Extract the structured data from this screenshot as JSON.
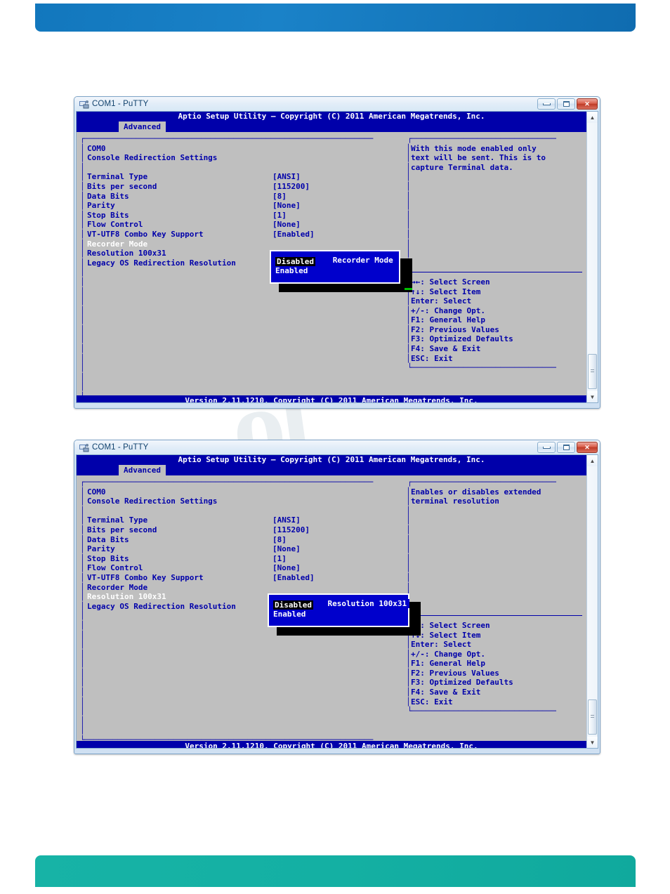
{
  "document": {
    "banner_top_color": "#1277bd",
    "banner_bottom_color": "#14b0a3",
    "watermark_text": "ol"
  },
  "windows": [
    {
      "id": "window-1",
      "titlebar": {
        "title": "COM1 - PuTTY",
        "minimize_label": "—",
        "maximize_label": "□",
        "close_label": "✕"
      },
      "bios": {
        "header": "Aptio Setup Utility – Copyright (C) 2011 American Megatrends, Inc.",
        "tab": "Advanced",
        "section_title_1": "COM0",
        "section_title_2": "Console Redirection Settings",
        "settings": [
          {
            "label": "Terminal Type",
            "value": "[ANSI]",
            "selected": false
          },
          {
            "label": "Bits per second",
            "value": "[115200]",
            "selected": false
          },
          {
            "label": "Data Bits",
            "value": "[8]",
            "selected": false
          },
          {
            "label": "Parity",
            "value": "[None]",
            "selected": false
          },
          {
            "label": "Stop Bits",
            "value": "[1]",
            "selected": false
          },
          {
            "label": "Flow Control",
            "value": "[None]",
            "selected": false
          },
          {
            "label": "VT-UTF8 Combo Key Support",
            "value": "[Enabled]",
            "selected": false
          },
          {
            "label": "Recorder Mode",
            "value": "",
            "selected": true
          },
          {
            "label": "Resolution 100x31",
            "value": "",
            "selected": false
          },
          {
            "label": "Legacy OS Redirection Resolution",
            "value": "",
            "selected": false
          }
        ],
        "help_text": [
          "With this mode enabled only",
          "text will be sent. This is to",
          "capture Terminal data."
        ],
        "keys": [
          "→←: Select Screen",
          "↑↓: Select Item",
          "Enter: Select",
          "+/-: Change Opt.",
          "F1: General Help",
          "F2: Previous Values",
          "F3: Optimized Defaults",
          "F4: Save & Exit",
          "ESC: Exit"
        ],
        "footer": "Version 2.11.1210. Copyright (C) 2011 American Megatrends, Inc."
      },
      "popup": {
        "title": "Recorder Mode",
        "options": [
          {
            "label": "Disabled",
            "highlighted": true
          },
          {
            "label": "Enabled",
            "highlighted": false
          }
        ]
      }
    },
    {
      "id": "window-2",
      "titlebar": {
        "title": "COM1 - PuTTY",
        "minimize_label": "—",
        "maximize_label": "□",
        "close_label": "✕"
      },
      "bios": {
        "header": "Aptio Setup Utility – Copyright (C) 2011 American Megatrends, Inc.",
        "tab": "Advanced",
        "section_title_1": "COM0",
        "section_title_2": "Console Redirection Settings",
        "settings": [
          {
            "label": "Terminal Type",
            "value": "[ANSI]",
            "selected": false
          },
          {
            "label": "Bits per second",
            "value": "[115200]",
            "selected": false
          },
          {
            "label": "Data Bits",
            "value": "[8]",
            "selected": false
          },
          {
            "label": "Parity",
            "value": "[None]",
            "selected": false
          },
          {
            "label": "Stop Bits",
            "value": "[1]",
            "selected": false
          },
          {
            "label": "Flow Control",
            "value": "[None]",
            "selected": false
          },
          {
            "label": "VT-UTF8 Combo Key Support",
            "value": "[Enabled]",
            "selected": false
          },
          {
            "label": "Recorder Mode",
            "value": "",
            "selected": false
          },
          {
            "label": "Resolution 100x31",
            "value": "",
            "selected": true
          },
          {
            "label": "Legacy OS Redirection Resolution",
            "value": "",
            "selected": false
          }
        ],
        "help_text": [
          "Enables or disables extended",
          "terminal resolution"
        ],
        "keys": [
          "→←: Select Screen",
          "↑↓: Select Item",
          "Enter: Select",
          "+/-: Change Opt.",
          "F1: General Help",
          "F2: Previous Values",
          "F3: Optimized Defaults",
          "F4: Save & Exit",
          "ESC: Exit"
        ],
        "footer": "Version 2.11.1210. Copyright (C) 2011 American Megatrends, Inc."
      },
      "popup": {
        "title": "Resolution 100x31",
        "options": [
          {
            "label": "Disabled",
            "highlighted": true
          },
          {
            "label": "Enabled",
            "highlighted": false
          }
        ]
      }
    }
  ]
}
